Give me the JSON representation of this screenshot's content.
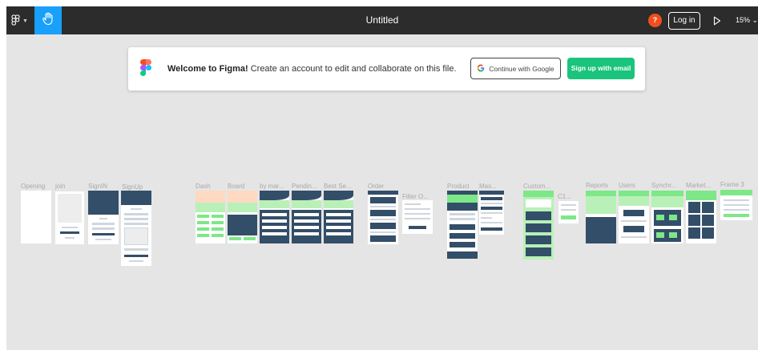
{
  "toolbar": {
    "menu_icon": "figma-menu-icon",
    "hand_icon": "hand-tool-icon",
    "title": "Untitled",
    "avatar_letter": "?",
    "login_label": "Log in",
    "play_icon": "play-icon",
    "zoom": "15% ⌄"
  },
  "banner": {
    "welcome_bold": "Welcome to Figma!",
    "welcome_text": " Create an account to edit and collaborate on this file.",
    "google_label": "Continue with Google",
    "email_label": "Sign up with email"
  },
  "frames": [
    {
      "label": "Opening"
    },
    {
      "label": "join"
    },
    {
      "label": "SignIN"
    },
    {
      "label": "SignUp"
    },
    {
      "label": "Dash"
    },
    {
      "label": "Board"
    },
    {
      "label": "by mar..."
    },
    {
      "label": "Pendin..."
    },
    {
      "label": "Best Se..."
    },
    {
      "label": "Order"
    },
    {
      "label": "Filter O..."
    },
    {
      "label": "Product"
    },
    {
      "label": "Mas..."
    },
    {
      "label": "Custom..."
    },
    {
      "label": "C1..."
    },
    {
      "label": "Reports"
    },
    {
      "label": "Users"
    },
    {
      "label": "Synchr..."
    },
    {
      "label": "Market..."
    },
    {
      "label": "Frame 3"
    }
  ],
  "colors": {
    "toolbar": "#2c2c2c",
    "canvas": "#e5e5e5",
    "accent_blue": "#18a0fb",
    "signup_green": "#1bc47d",
    "design_navy": "#334e68",
    "design_green": "#7ee787"
  }
}
